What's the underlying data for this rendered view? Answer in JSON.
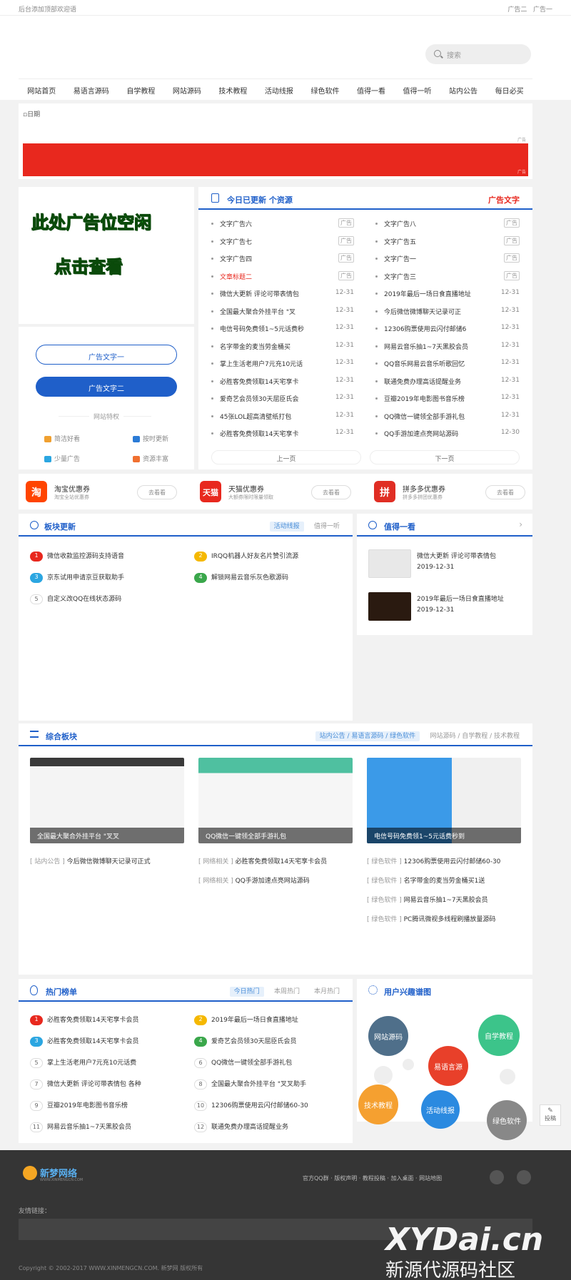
{
  "topbar": {
    "welcome": "后台添加顶部欢迎语",
    "links": [
      "广告二",
      "广告一"
    ]
  },
  "search": {
    "placeholder": "搜索"
  },
  "nav": [
    "网站首页",
    "易语言源码",
    "自学教程",
    "网站源码",
    "技术教程",
    "活动线报",
    "绿色软件",
    "值得一看",
    "值得一听",
    "站内公告",
    "每日必买"
  ],
  "banner": {
    "alt": "日期",
    "tag": "广告"
  },
  "adbox": {
    "line1": "此处广告位空闲",
    "line2": "点击查看"
  },
  "side_buttons": {
    "btn1": "广告文字一",
    "btn2": "广告文字二",
    "feature_title": "网站特权",
    "features": [
      "简洁好看",
      "按时更新",
      "少量广告",
      "资源丰富"
    ]
  },
  "latest": {
    "title": "今日已更新 个资源",
    "red": "广告文字",
    "left": [
      {
        "t": "文字广告六",
        "d": "广告"
      },
      {
        "t": "文字广告七",
        "d": "广告"
      },
      {
        "t": "文字广告四",
        "d": "广告"
      },
      {
        "t": "文章标题二",
        "d": "广告"
      },
      {
        "t": "微信大更新 评论可带表情包",
        "d": "12-31"
      },
      {
        "t": "全国最大聚合外挂平台 \"叉",
        "d": "12-31"
      },
      {
        "t": "电信号码免费领1~5元话费秒",
        "d": "12-31"
      },
      {
        "t": "名字带金的麦当劳金桶买",
        "d": "12-31"
      },
      {
        "t": "掌上生活老用户7元充10元话",
        "d": "12-31"
      },
      {
        "t": "必胜客免费领取14天宅享卡",
        "d": "12-31"
      },
      {
        "t": "爱奇艺会员领30天屈臣氏会",
        "d": "12-31"
      },
      {
        "t": "45张LOL超高清壁纸打包",
        "d": "12-31"
      },
      {
        "t": "必胜客免费领取14天宅享卡",
        "d": "12-31"
      }
    ],
    "right": [
      {
        "t": "文字广告八",
        "d": "广告"
      },
      {
        "t": "文字广告五",
        "d": "广告"
      },
      {
        "t": "文字广告一",
        "d": "广告"
      },
      {
        "t": "文字广告三",
        "d": "广告"
      },
      {
        "t": "2019年最后一场日食直播地址",
        "d": "12-31"
      },
      {
        "t": "今后微信微博聊天记录可正",
        "d": "12-31"
      },
      {
        "t": "12306购票使用云闪付邮储6",
        "d": "12-31"
      },
      {
        "t": "网易云音乐抽1~7天黑胶会员",
        "d": "12-31"
      },
      {
        "t": "QQ音乐网易云音乐听歌回忆",
        "d": "12-31"
      },
      {
        "t": "联通免费办理高话提醒业务",
        "d": "12-31"
      },
      {
        "t": "豆瓣2019年电影图书音乐榜",
        "d": "12-31"
      },
      {
        "t": "QQ微信一键领全部手游礼包",
        "d": "12-31"
      },
      {
        "t": "QQ手游加速点亮网站源码",
        "d": "12-30"
      }
    ],
    "prev": "上一页",
    "next": "下一页"
  },
  "coupons": [
    {
      "logo": "淘",
      "name": "淘宝优惠券",
      "desc": "淘宝全站优惠券",
      "btn": "去看看",
      "color": "#ff4400"
    },
    {
      "logo": "天猫",
      "name": "天猫优惠券",
      "desc": "大额券限时限量领取",
      "btn": "去看看",
      "color": "#e8281e"
    },
    {
      "logo": "拼",
      "name": "拼多多优惠券",
      "desc": "拼多多拼团优惠券",
      "btn": "去看看",
      "color": "#e02e24"
    }
  ],
  "blocks": {
    "title": "板块更新",
    "tabs": [
      "活动线报",
      "值得一听"
    ],
    "items": [
      "微信收款监控源码支持语音",
      "IRQQ机器人好友名片赞引流源",
      "京东试用申请京豆获取助手",
      "解锁网易云音乐灰色歌源码",
      "自定义改QQ在线状态源码"
    ]
  },
  "worth": {
    "title": "值得一看",
    "items": [
      {
        "t": "微信大更新 评论可带表情包",
        "d": "2019-12-31"
      },
      {
        "t": "2019年最后一场日食直播地址",
        "d": "2019-12-31"
      }
    ]
  },
  "composite": {
    "title": "综合板块",
    "tab_on": "站内公告 / 易语言源码 / 绿色软件",
    "tab_off": "网站源码 / 自学教程 / 技术教程",
    "cards": [
      "全国最大聚合外挂平台 \"叉叉",
      "QQ微信一键领全部手游礼包",
      "电信号码免费领1~5元话费秒到"
    ],
    "col1": [
      {
        "c": "[ 站内公告 ]",
        "t": "今后微信微博聊天记录可正式"
      }
    ],
    "col2": [
      {
        "c": "[ 网络相关 ]",
        "t": "必胜客免费领取14天宅享卡会员"
      },
      {
        "c": "[ 网络相关 ]",
        "t": "QQ手游加速点亮网站源码"
      }
    ],
    "col3": [
      {
        "c": "[ 绿色软件 ]",
        "t": "12306购票使用云闪付邮储60-30"
      },
      {
        "c": "[ 绿色软件 ]",
        "t": "名字带金的麦当劳金桶买1送"
      },
      {
        "c": "[ 绿色软件 ]",
        "t": "网易云音乐抽1~7天黑胶会员"
      },
      {
        "c": "[ 绿色软件 ]",
        "t": "PC腾讯微视多线程刷播放量源码"
      }
    ]
  },
  "hot": {
    "title": "热门榜单",
    "tabs": [
      "今日热门",
      "本周热门",
      "本月热门"
    ],
    "items": [
      "必胜客免费领取14天宅享卡会员",
      "2019年最后一场日食直播地址",
      "必胜客免费领取14天宅享卡会员",
      "爱奇艺会员领30天屈臣氏会员",
      "掌上生活老用户7元充10元话费",
      "QQ微信一键领全部手游礼包",
      "微信大更新 评论可带表情包 各种",
      "全国最大聚合外挂平台 \"叉叉助手",
      "豆瓣2019年电影图书音乐榜",
      "12306购票使用云闪付邮储60-30",
      "网易云音乐抽1~7天黑胶会员",
      "联通免费办理高话提醒业务"
    ]
  },
  "interest": {
    "title": "用户兴趣谱图",
    "bubbles": [
      "网站源码",
      "自学教程",
      "易语言源",
      "技术教程",
      "活动线报",
      "绿色软件"
    ]
  },
  "footer": {
    "logo": "新梦网络",
    "logo_sub": "WWW.XINMENGCN.COM",
    "links": [
      "官方QQ群",
      "版权声明",
      "教程投稿",
      "加入桌面",
      "网站地图"
    ],
    "friend": "友情链接：",
    "copyright": "Copyright © 2002-2017 WWW.XINMENGCN.COM. 新梦网 版权所有"
  },
  "watermark": {
    "line1": "XYDai.cn",
    "line2": "新源代源码社区"
  },
  "tougao": "投稿"
}
